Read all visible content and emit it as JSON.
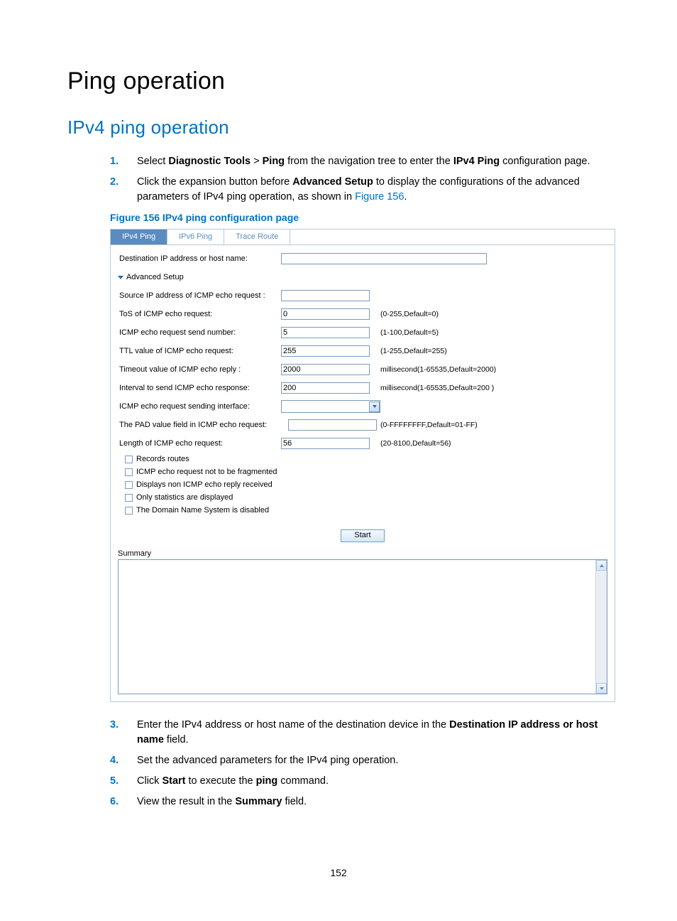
{
  "headings": {
    "h1": "Ping operation",
    "h2": "IPv4 ping operation"
  },
  "steps": {
    "s1": {
      "a": "Select ",
      "b1": "Diagnostic Tools",
      "gt": " > ",
      "b2": "Ping",
      "c": " from the navigation tree to enter the ",
      "b3": "IPv4 Ping",
      "d": " configuration page."
    },
    "s2": {
      "a": "Click the expansion button before ",
      "b1": "Advanced Setup",
      "c": " to display the configurations of the advanced parameters of IPv4 ping operation, as shown in ",
      "link": "Figure 156",
      "d": "."
    },
    "s3": {
      "a": "Enter the IPv4 address or host name of the destination device in the ",
      "b1": "Destination IP address or host name",
      "c": " field."
    },
    "s4": "Set the advanced parameters for the IPv4 ping operation.",
    "s5": {
      "a": "Click ",
      "b1": "Start",
      "c": " to execute the ",
      "b2": "ping",
      "d": " command."
    },
    "s6": {
      "a": "View the result in the ",
      "b1": "Summary",
      "c": " field."
    }
  },
  "figcap": "Figure 156 IPv4 ping configuration page",
  "tabs": {
    "t1": "IPv4 Ping",
    "t2": "IPv6 Ping",
    "t3": "Trace Route"
  },
  "form": {
    "dest_label": "Destination IP address or host name:",
    "advanced": "Advanced Setup",
    "src_label": "Source IP address of ICMP echo request :",
    "tos": {
      "label": "ToS of ICMP echo request:",
      "value": "0",
      "hint": "(0-255,Default=0)"
    },
    "sendnum": {
      "label": "ICMP echo request send number:",
      "value": "5",
      "hint": "(1-100,Default=5)"
    },
    "ttl": {
      "label": "TTL value of ICMP echo request:",
      "value": "255",
      "hint": "(1-255,Default=255)"
    },
    "timeout": {
      "label": "Timeout value of ICMP echo reply :",
      "value": "2000",
      "hint": "millisecond(1-65535,Default=2000)"
    },
    "interval": {
      "label": "Interval to send ICMP echo response:",
      "value": "200",
      "hint": "millisecond(1-65535,Default=200 )"
    },
    "iface": {
      "label": "ICMP echo request sending interface:"
    },
    "pad": {
      "label": "The PAD value field in ICMP echo request:",
      "hint": "(0-FFFFFFFF,Default=01-FF)"
    },
    "length": {
      "label": "Length of ICMP echo request:",
      "value": "56",
      "hint": "(20-8100,Default=56)"
    },
    "checks": {
      "c1": "Records routes",
      "c2": "ICMP echo request not to be fragmented",
      "c3": "Displays non ICMP echo reply received",
      "c4": "Only statistics are displayed",
      "c5": "The Domain Name System is disabled"
    },
    "start": "Start",
    "summary": "Summary"
  },
  "page_number": "152"
}
